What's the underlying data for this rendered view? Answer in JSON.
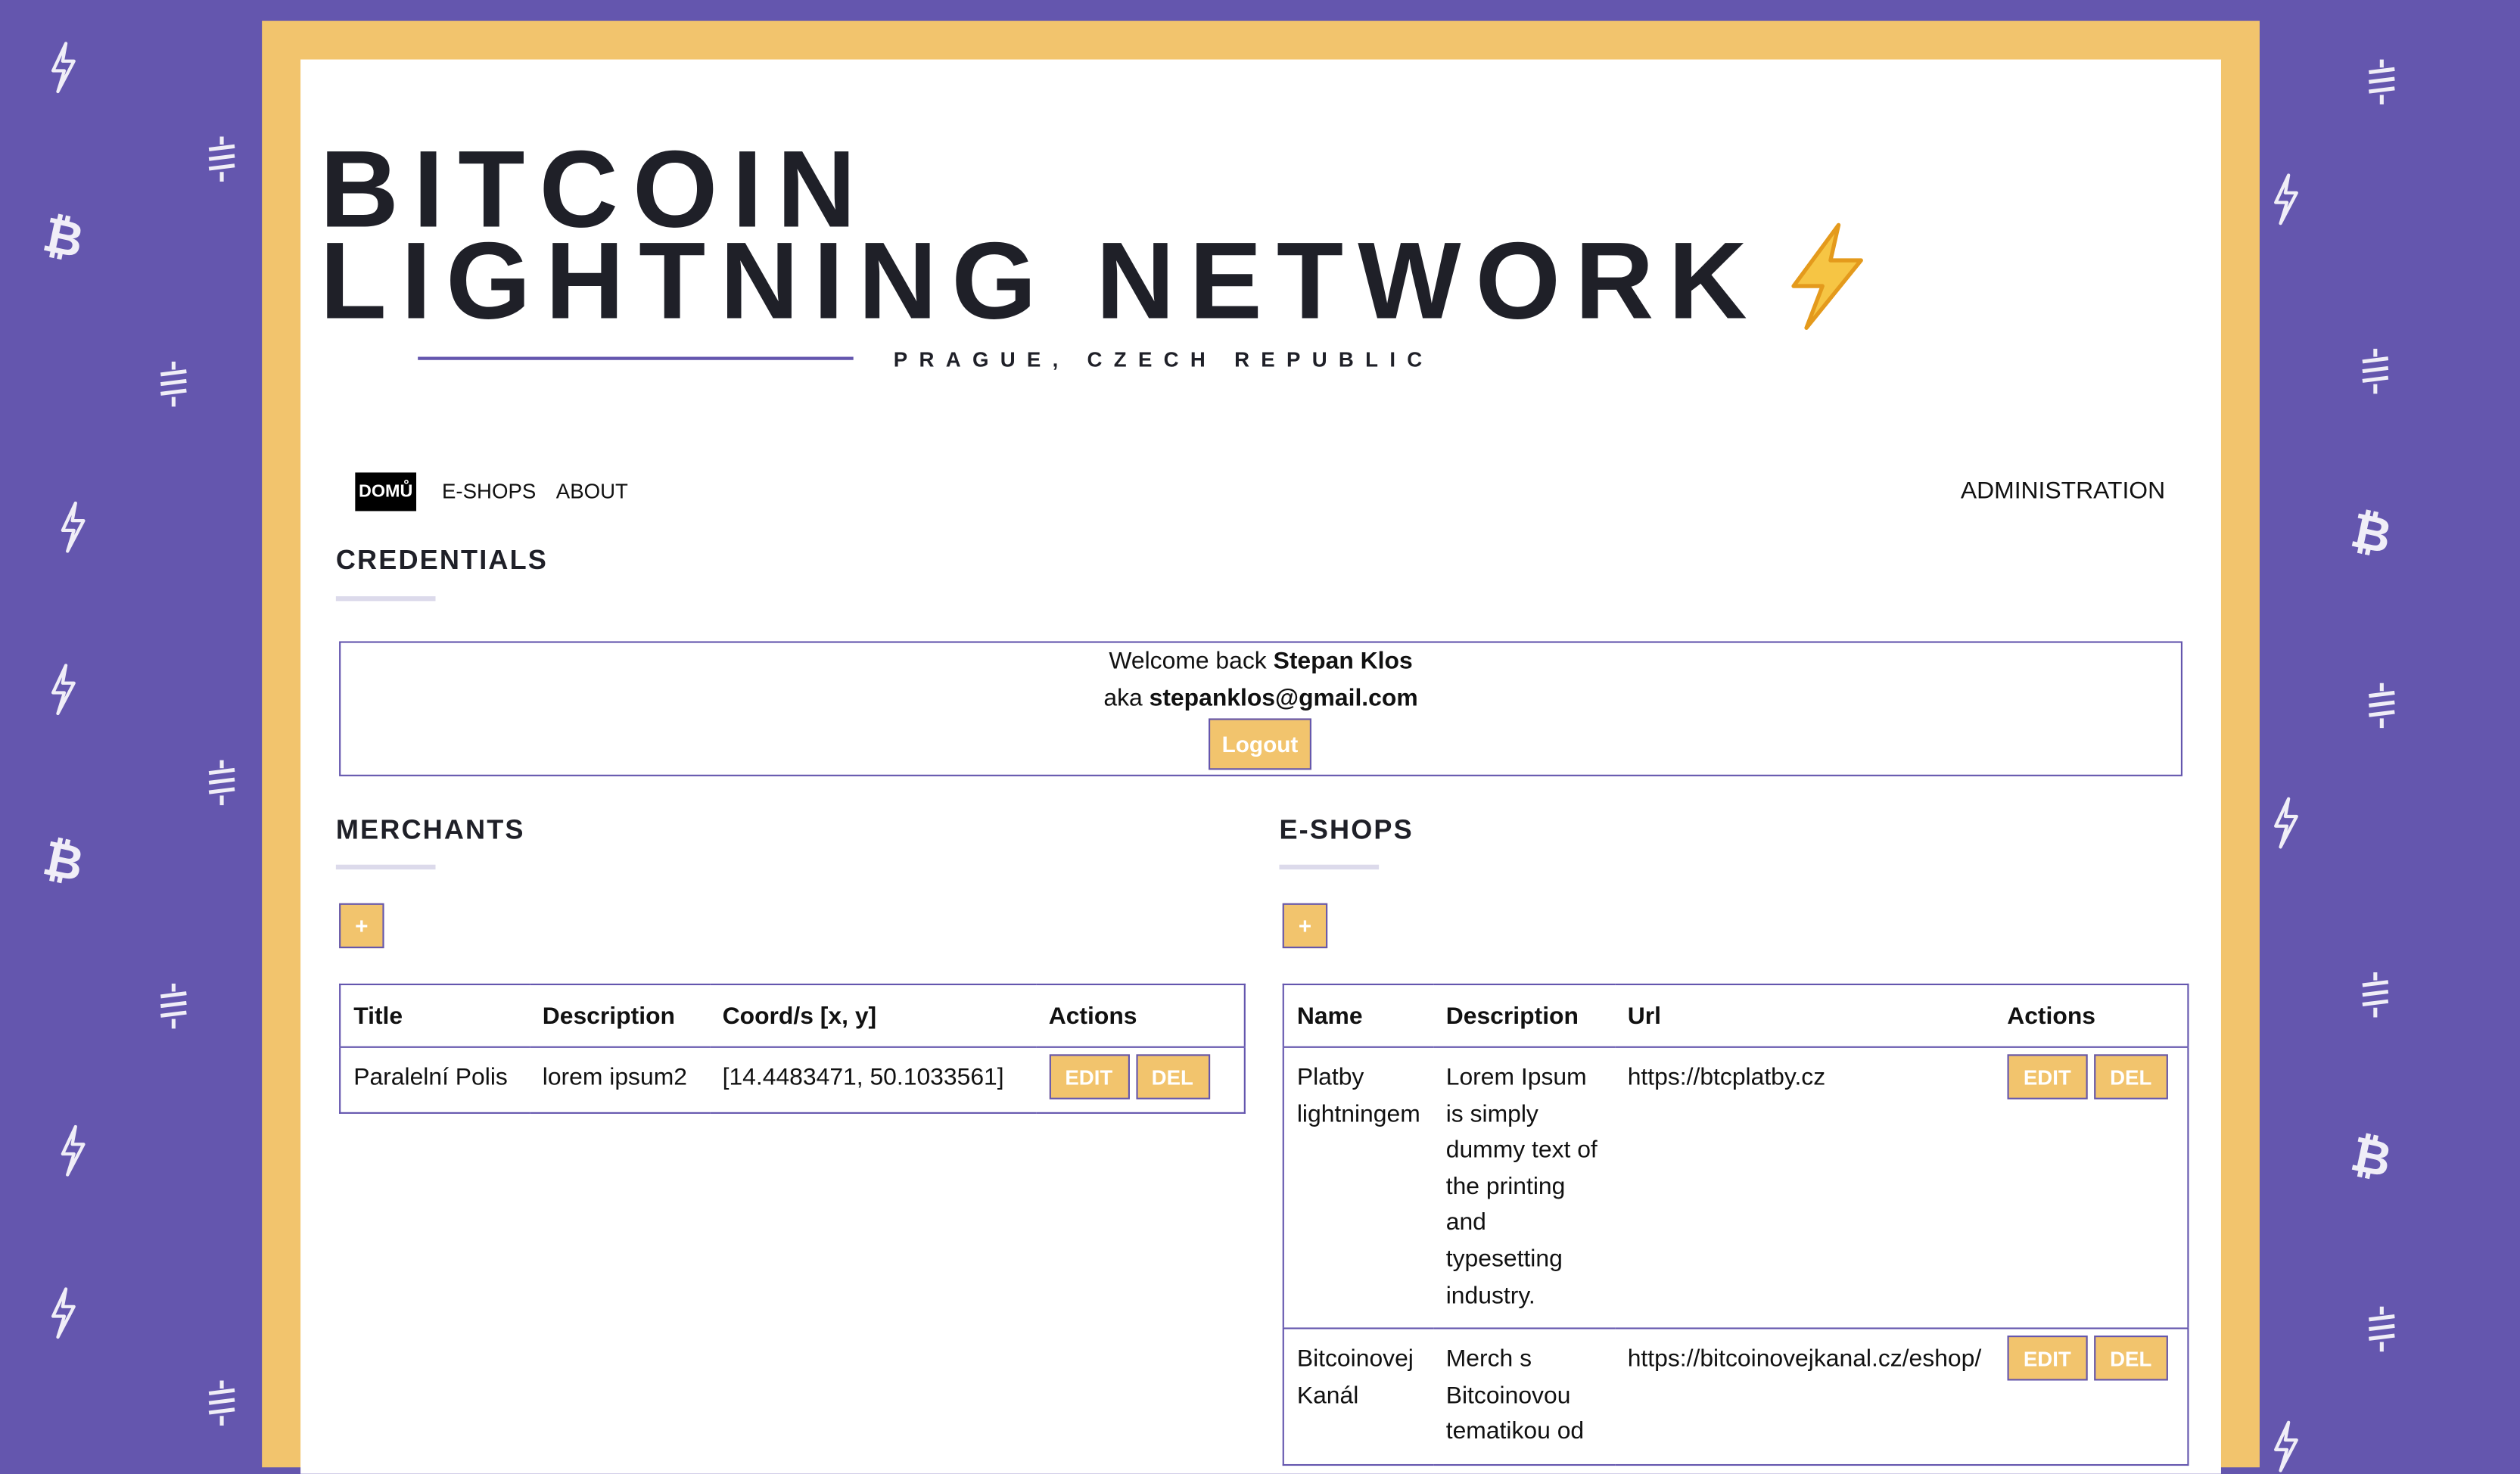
{
  "header": {
    "title_line1": "BITCOIN",
    "title_line2": "LIGHTNING NETWORK",
    "subtitle": "PRAGUE, CZECH REPUBLIC"
  },
  "nav": {
    "home": "DOMŮ",
    "eshops": "E-SHOPS",
    "about": "ABOUT",
    "admin": "ADMINISTRATION"
  },
  "credentials": {
    "title": "CREDENTIALS",
    "welcome_prefix": "Welcome back ",
    "name": "Stepan Klos",
    "aka_prefix": "aka ",
    "email": "stepanklos@gmail.com",
    "logout_label": "Logout"
  },
  "merchants": {
    "title": "MERCHANTS",
    "add_label": "+",
    "columns": [
      "Title",
      "Description",
      "Coord/s [x, y]",
      "Actions"
    ],
    "rows": [
      {
        "title": "Paralelní Polis",
        "description": "lorem ipsum2",
        "coords": "[14.4483471, 50.1033561]",
        "edit": "EDIT",
        "del": "DEL"
      }
    ]
  },
  "eshops": {
    "title": "E-SHOPS",
    "add_label": "+",
    "columns": [
      "Name",
      "Description",
      "Url",
      "Actions"
    ],
    "rows": [
      {
        "name": "Platby lightningem",
        "description": "Lorem Ipsum is simply dummy text of the printing and typesetting industry.",
        "url": "https://btcplatby.cz",
        "edit": "EDIT",
        "del": "DEL"
      },
      {
        "name": "Bitcoinovej Kanál",
        "description": "Merch s Bitcoinovou tematikou od",
        "url": "https://bitcoinovejkanal.cz/eshop/",
        "edit": "EDIT",
        "del": "DEL"
      }
    ]
  },
  "colors": {
    "background": "#6456AE",
    "frame": "#F2C46D",
    "accent": "#6456AE",
    "button": "#F2C46D"
  },
  "icons": [
    "lightning-icon",
    "satoshi-icon",
    "bitcoin-icon"
  ]
}
